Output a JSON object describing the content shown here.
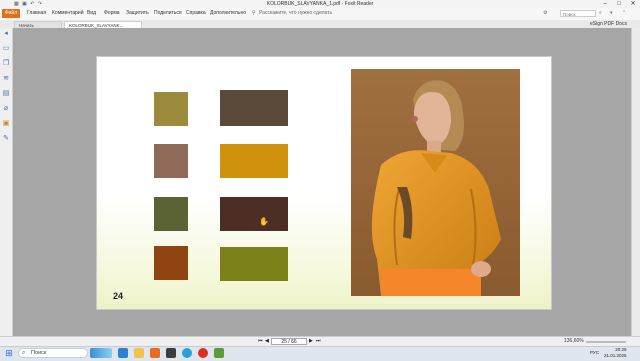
{
  "titlebar": {
    "title": "KOLORBUK_SLAVYANKA_1.pdf - Foxit Reader",
    "quick_access": "▦ ▣ ↶ ↷"
  },
  "ribbon": {
    "file_label": "Файл",
    "menu": [
      "Главная",
      "Комментарий",
      "Вид",
      "Форма",
      "Защитить",
      "Поделиться",
      "Справка",
      "Дополнительно"
    ],
    "search_hint": "Расскажите, что нужно сделать",
    "find_placeholder": "Поиск"
  },
  "tabs": [
    {
      "label": "Начать",
      "active": false
    },
    {
      "label": "KOLORBUK_SLAVYANK...",
      "active": true
    }
  ],
  "esign_label": "eSign PDF Docs",
  "page": {
    "number": "24",
    "swatches_small": [
      "#9c8a3d",
      "#8f6a59",
      "#5b6334",
      "#8f4412"
    ],
    "swatches_large": [
      "#5b4a39",
      "#d0920c",
      "#4c2e24",
      "#7b8019"
    ]
  },
  "statusbar": {
    "page_indicator": "25 / 66",
    "zoom": "136,60%"
  },
  "taskbar": {
    "search_label": "Поиск",
    "lang": "РУС",
    "time": "20:29",
    "date": "21.01.2025"
  }
}
